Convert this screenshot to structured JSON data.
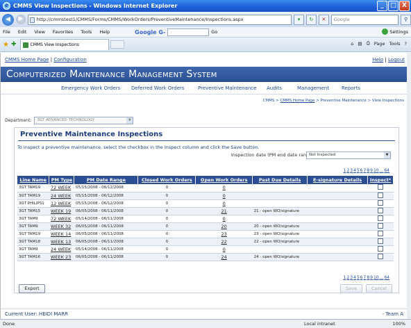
{
  "window": {
    "title": "CMMS View Inspections - Windows Internet Explorer",
    "min": "_",
    "max": "□",
    "close": "X"
  },
  "address": {
    "url": "http://cmmstest1/CMMS/Forms/CMMS/WorkOrders/PreventiveMaintenance/Inspections.aspx",
    "search_placeholder": "Google"
  },
  "menu": {
    "items": [
      "File",
      "Edit",
      "View",
      "Favorites",
      "Tools",
      "Help"
    ],
    "google": "Google G-",
    "go": "Go",
    "settings": "Settings"
  },
  "tab": {
    "label": "CMMS View Inspections"
  },
  "toolbar": {
    "page": "Page",
    "tools": "Tools"
  },
  "toplinks": {
    "home": "CMMS Home Page",
    "sep": "|",
    "config": "Configuration",
    "help": "Help",
    "logout": "Logout"
  },
  "banner": "Computerized Maintenance Management System",
  "nav": [
    "Emergency Work Orders",
    "Deferred Work Orders",
    "Preventive Maintenance",
    "Audits",
    "Management",
    "Reports"
  ],
  "breadcrumb": {
    "cmms": "CMMS >",
    "home": "CMMS Home Page",
    "rest": "> Preventive Maintenance > View Inspections"
  },
  "department": {
    "label": "Department:",
    "value": "3GT ADVANCED TECHNOLOGY"
  },
  "panel": {
    "title": "Preventive Maintenance Inspections",
    "instructions": "To inspect a preventive maintenance, select the checkbox in the Inspect column and click the Save button.",
    "inspection_label": "Inspection date (PM end date range):",
    "inspection_value": "Not Inspected"
  },
  "pager": [
    "1",
    "2",
    "3",
    "4",
    "5",
    "6",
    "7",
    "8",
    "9",
    "10",
    "...",
    "64"
  ],
  "table": {
    "headers": [
      "Line Name",
      "PM Type",
      "PM Date Range",
      "Closed Work Orders",
      "Open Work Orders",
      "Past Due Details",
      "E-signature Details",
      "Inspect*"
    ],
    "rows": [
      [
        "3GT TAM19",
        "72 WEEK",
        "05/15/2008 - 06/12/2008",
        "0",
        "0",
        "",
        ""
      ],
      [
        "3GT TAM19",
        "24 WEEK",
        "05/15/2008 - 06/12/2008",
        "0",
        "0",
        "",
        ""
      ],
      [
        "3GT PHILIPS1",
        "12 WEEK",
        "05/15/2008 - 06/12/2008",
        "0",
        "0",
        "",
        ""
      ],
      [
        "3GT TAM15",
        "WEEK 19",
        "06/05/2008 - 06/11/2008",
        "0",
        "21",
        "21 - open WO/signature",
        ""
      ],
      [
        "3GT TAM9",
        "72 WEEK",
        "05/14/2008 - 06/11/2008",
        "0",
        "0",
        "",
        ""
      ],
      [
        "3GT TAM9",
        "WEEK 32",
        "06/05/2008 - 06/11/2008",
        "0",
        "20",
        "20 - open WO/signature",
        ""
      ],
      [
        "3GT TAM19",
        "WEEK 14",
        "06/05/2008 - 06/11/2008",
        "0",
        "23",
        "23 - open WO/signature",
        ""
      ],
      [
        "3GT TAM18",
        "WEEK 13",
        "06/05/2008 - 06/11/2008",
        "0",
        "22",
        "22 - open WO/signature",
        ""
      ],
      [
        "3GT TAM9",
        "24 WEEK",
        "05/14/2008 - 06/11/2008",
        "0",
        "0",
        "",
        ""
      ],
      [
        "3GT TAM16",
        "WEEK 23",
        "06/05/2008 - 06/11/2008",
        "0",
        "24",
        "24 - open WO/signature",
        ""
      ]
    ]
  },
  "buttons": {
    "export": "Export",
    "save": "Save",
    "cancel": "Cancel"
  },
  "footer": {
    "user": "Current User: HEIDI MARR",
    "team": "- Team A"
  },
  "status": {
    "left": "Done",
    "zone": "Local intranet",
    "zoom": "100%"
  }
}
